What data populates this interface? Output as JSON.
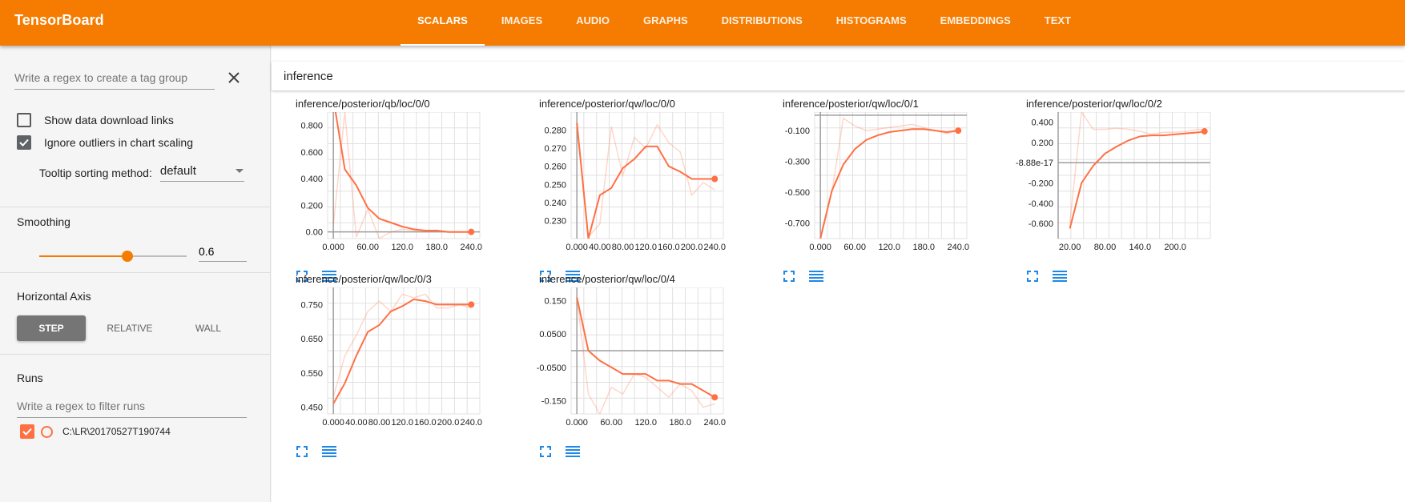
{
  "app": {
    "title": "TensorBoard",
    "accent_color": "#f57c00",
    "tabs": [
      {
        "label": "SCALARS",
        "active": true
      },
      {
        "label": "IMAGES",
        "active": false
      },
      {
        "label": "AUDIO",
        "active": false
      },
      {
        "label": "GRAPHS",
        "active": false
      },
      {
        "label": "DISTRIBUTIONS",
        "active": false
      },
      {
        "label": "HISTOGRAMS",
        "active": false
      },
      {
        "label": "EMBEDDINGS",
        "active": false
      },
      {
        "label": "TEXT",
        "active": false
      }
    ]
  },
  "sidebar": {
    "tag_regex": {
      "placeholder": "Write a regex to create a tag group",
      "value": "",
      "clear_icon": "close-icon"
    },
    "show_download_links": {
      "label": "Show data download links",
      "checked": false
    },
    "ignore_outliers": {
      "label": "Ignore outliers in chart scaling",
      "checked": true
    },
    "tooltip_sorting": {
      "label": "Tooltip sorting method:",
      "value": "default"
    },
    "smoothing": {
      "title": "Smoothing",
      "value": "0.6",
      "fraction": 0.6
    },
    "horizontal_axis": {
      "title": "Horizontal Axis",
      "options": [
        "STEP",
        "RELATIVE",
        "WALL"
      ],
      "selected": "STEP"
    },
    "runs": {
      "title": "Runs",
      "filter_placeholder": "Write a regex to filter runs",
      "items": [
        {
          "name": "C:\\LR\\20170527T190744",
          "checked": true,
          "color": "#ff7043"
        }
      ]
    }
  },
  "main": {
    "category": "inference",
    "card_icons": [
      "expand-icon",
      "toggle-log-scale-icon"
    ],
    "series_color": "#ff7043"
  },
  "chart_data": [
    {
      "type": "line",
      "title": "inference/posterior/qb/loc/0/0",
      "xlabel": "",
      "ylabel": "",
      "xlim": [
        -10,
        255
      ],
      "ylim": [
        -0.05,
        0.9
      ],
      "x_ticks": [
        0,
        60,
        120,
        180,
        240
      ],
      "x_tick_labels": [
        "0.000",
        "60.00",
        "120.0",
        "180.0",
        "240.0"
      ],
      "y_ticks": [
        0,
        0.2,
        0.4,
        0.6,
        0.8
      ],
      "y_tick_labels": [
        "0.00",
        "0.200",
        "0.400",
        "0.600",
        "0.800"
      ],
      "series": [
        {
          "x": [
            0,
            20,
            40,
            60,
            80,
            100,
            120,
            140,
            160,
            180,
            200,
            220,
            240
          ],
          "y": [
            0.05,
            0.9,
            -0.04,
            0.17,
            -0.05,
            0.0,
            0.02,
            0.01,
            0.0,
            0.01,
            0.0,
            0.0,
            0.0
          ],
          "style": "raw"
        },
        {
          "x": [
            0,
            20,
            40,
            60,
            80,
            100,
            120,
            140,
            160,
            180,
            200,
            220,
            240
          ],
          "y": [
            1.0,
            0.47,
            0.35,
            0.18,
            0.1,
            0.07,
            0.04,
            0.02,
            0.01,
            0.01,
            0.0,
            0.0,
            0.0
          ],
          "style": "smoothed"
        }
      ]
    },
    {
      "type": "line",
      "title": "inference/posterior/qw/loc/0/0",
      "xlabel": "",
      "ylabel": "",
      "xlim": [
        -10,
        255
      ],
      "ylim": [
        0.22,
        0.29
      ],
      "x_ticks": [
        0,
        40,
        80,
        120,
        160,
        200,
        240
      ],
      "x_tick_labels": [
        "0.000",
        "40.00",
        "80.00",
        "120.0",
        "160.0",
        "200.0",
        "240.0"
      ],
      "y_ticks": [
        0.23,
        0.24,
        0.25,
        0.26,
        0.27,
        0.28
      ],
      "y_tick_labels": [
        "0.230",
        "0.240",
        "0.250",
        "0.260",
        "0.270",
        "0.280"
      ],
      "series": [
        {
          "x": [
            0,
            20,
            40,
            60,
            80,
            100,
            120,
            140,
            160,
            180,
            200,
            220,
            240
          ],
          "y": [
            0.284,
            0.221,
            0.228,
            0.282,
            0.255,
            0.276,
            0.27,
            0.283,
            0.273,
            0.268,
            0.244,
            0.251,
            0.247
          ],
          "style": "raw"
        },
        {
          "x": [
            0,
            20,
            40,
            60,
            80,
            100,
            120,
            140,
            160,
            180,
            200,
            220,
            240
          ],
          "y": [
            0.284,
            0.22,
            0.244,
            0.248,
            0.259,
            0.264,
            0.271,
            0.271,
            0.26,
            0.257,
            0.253,
            0.253,
            0.253
          ],
          "style": "smoothed"
        }
      ]
    },
    {
      "type": "line",
      "title": "inference/posterior/qw/loc/0/1",
      "xlabel": "",
      "ylabel": "",
      "xlim": [
        -10,
        255
      ],
      "ylim": [
        -0.8,
        0.02
      ],
      "x_ticks": [
        0,
        60,
        120,
        180,
        240
      ],
      "x_tick_labels": [
        "0.000",
        "60.00",
        "120.0",
        "180.0",
        "240.0"
      ],
      "y_ticks": [
        -0.1,
        -0.3,
        -0.5,
        -0.7
      ],
      "y_tick_labels": [
        "-0.100",
        "-0.300",
        "-0.500",
        "-0.700"
      ],
      "series": [
        {
          "x": [
            0,
            20,
            40,
            60,
            80,
            100,
            120,
            140,
            160,
            180,
            200,
            220,
            240
          ],
          "y": [
            -0.78,
            -0.5,
            -0.02,
            -0.07,
            -0.1,
            -0.09,
            -0.08,
            -0.07,
            -0.06,
            -0.08,
            -0.1,
            -0.12,
            -0.1
          ],
          "style": "raw"
        },
        {
          "x": [
            0,
            20,
            40,
            60,
            80,
            100,
            120,
            140,
            160,
            180,
            200,
            220,
            240
          ],
          "y": [
            -0.8,
            -0.49,
            -0.32,
            -0.22,
            -0.16,
            -0.13,
            -0.11,
            -0.1,
            -0.09,
            -0.09,
            -0.1,
            -0.11,
            -0.1
          ],
          "style": "smoothed"
        }
      ]
    },
    {
      "type": "line",
      "title": "inference/posterior/qw/loc/0/2",
      "xlabel": "",
      "ylabel": "",
      "xlim": [
        0,
        260
      ],
      "ylim": [
        -0.75,
        0.5
      ],
      "x_ticks": [
        20,
        80,
        140,
        200
      ],
      "x_tick_labels": [
        "20.00",
        "80.00",
        "140.0",
        "200.0"
      ],
      "y_ticks": [
        0.4,
        0.2,
        0,
        -0.2,
        -0.4,
        -0.6
      ],
      "y_tick_labels": [
        "0.400",
        "0.200",
        "-8.88e-17",
        "-0.200",
        "-0.400",
        "-0.600"
      ],
      "series": [
        {
          "x": [
            20,
            40,
            60,
            80,
            100,
            120,
            140,
            160,
            180,
            200,
            220,
            240,
            250
          ],
          "y": [
            -0.6,
            0.5,
            0.33,
            0.33,
            0.34,
            0.33,
            0.31,
            0.28,
            0.3,
            0.3,
            0.31,
            0.33,
            0.32
          ],
          "style": "raw"
        },
        {
          "x": [
            20,
            40,
            60,
            80,
            100,
            120,
            140,
            160,
            180,
            200,
            220,
            240,
            250
          ],
          "y": [
            -0.65,
            -0.2,
            -0.03,
            0.09,
            0.16,
            0.22,
            0.26,
            0.27,
            0.27,
            0.28,
            0.29,
            0.3,
            0.31
          ],
          "style": "smoothed"
        }
      ]
    },
    {
      "type": "line",
      "title": "inference/posterior/qw/loc/0/3",
      "xlabel": "",
      "ylabel": "",
      "xlim": [
        -10,
        255
      ],
      "ylim": [
        0.43,
        0.8
      ],
      "x_ticks": [
        0,
        40,
        80,
        120,
        160,
        200,
        240
      ],
      "x_tick_labels": [
        "0.000",
        "40.00",
        "80.00",
        "120.0",
        "160.0",
        "200.0",
        "240.0"
      ],
      "y_ticks": [
        0.75,
        0.65,
        0.55,
        0.45
      ],
      "y_tick_labels": [
        "0.750",
        "0.650",
        "0.550",
        "0.450"
      ],
      "series": [
        {
          "x": [
            0,
            20,
            40,
            60,
            80,
            100,
            120,
            140,
            160,
            180,
            200,
            220,
            240
          ],
          "y": [
            0.48,
            0.6,
            0.66,
            0.73,
            0.76,
            0.73,
            0.78,
            0.77,
            0.78,
            0.74,
            0.74,
            0.75,
            0.74
          ],
          "style": "raw"
        },
        {
          "x": [
            0,
            20,
            40,
            60,
            80,
            100,
            120,
            140,
            160,
            180,
            200,
            220,
            240
          ],
          "y": [
            0.46,
            0.52,
            0.6,
            0.67,
            0.69,
            0.73,
            0.745,
            0.765,
            0.76,
            0.75,
            0.75,
            0.75,
            0.75
          ],
          "style": "smoothed"
        }
      ]
    },
    {
      "type": "line",
      "title": "inference/posterior/qw/loc/0/4",
      "xlabel": "",
      "ylabel": "",
      "xlim": [
        -10,
        255
      ],
      "ylim": [
        -0.19,
        0.19
      ],
      "x_ticks": [
        0,
        60,
        120,
        180,
        240
      ],
      "x_tick_labels": [
        "0.000",
        "60.00",
        "120.0",
        "180.0",
        "240.0"
      ],
      "y_ticks": [
        0.15,
        0.05,
        -0.05,
        -0.15
      ],
      "y_tick_labels": [
        "0.150",
        "0.0500",
        "-0.0500",
        "-0.150"
      ],
      "series": [
        {
          "x": [
            0,
            20,
            40,
            60,
            80,
            100,
            120,
            140,
            160,
            180,
            200,
            220,
            240
          ],
          "y": [
            0.16,
            -0.13,
            -0.19,
            -0.11,
            -0.13,
            -0.07,
            -0.08,
            -0.11,
            -0.14,
            -0.1,
            -0.12,
            -0.17,
            -0.16
          ],
          "style": "raw"
        },
        {
          "x": [
            0,
            20,
            40,
            60,
            80,
            100,
            120,
            140,
            160,
            180,
            200,
            220,
            240
          ],
          "y": [
            0.16,
            0.0,
            -0.03,
            -0.05,
            -0.07,
            -0.07,
            -0.07,
            -0.09,
            -0.09,
            -0.1,
            -0.1,
            -0.12,
            -0.14
          ],
          "style": "smoothed"
        }
      ]
    }
  ]
}
